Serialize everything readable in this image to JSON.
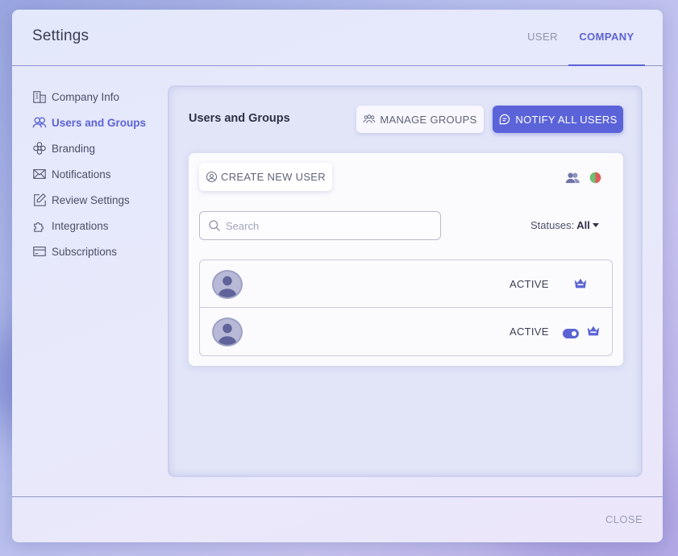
{
  "modal": {
    "title": "Settings",
    "tabs": [
      {
        "label": "USER",
        "active": false
      },
      {
        "label": "COMPANY",
        "active": true
      }
    ],
    "accent_color": "#5b63d4"
  },
  "sidebar": {
    "items": [
      {
        "label": "Company Info",
        "icon": "building-icon",
        "active": false
      },
      {
        "label": "Users and Groups",
        "icon": "users-icon",
        "active": true
      },
      {
        "label": "Branding",
        "icon": "flower-icon",
        "active": false
      },
      {
        "label": "Notifications",
        "icon": "envelope-icon",
        "active": false
      },
      {
        "label": "Review Settings",
        "icon": "edit-icon",
        "active": false
      },
      {
        "label": "Integrations",
        "icon": "puzzle-icon",
        "active": false
      },
      {
        "label": "Subscriptions",
        "icon": "credit-card-icon",
        "active": false
      }
    ]
  },
  "panel": {
    "title": "Users and Groups",
    "manage_groups_label": "MANAGE GROUPS",
    "notify_all_label": "NOTIFY ALL USERS",
    "create_user_label": "CREATE NEW USER",
    "search": {
      "placeholder": "Search",
      "value": ""
    },
    "status_filter": {
      "label": "Statuses:",
      "value": "All"
    },
    "users": [
      {
        "status": "ACTIVE",
        "toggle": false,
        "admin_icon": "crown-icon"
      },
      {
        "status": "ACTIVE",
        "toggle": true,
        "admin_icon": "crown-icon"
      }
    ]
  },
  "footer": {
    "close_label": "CLOSE"
  }
}
